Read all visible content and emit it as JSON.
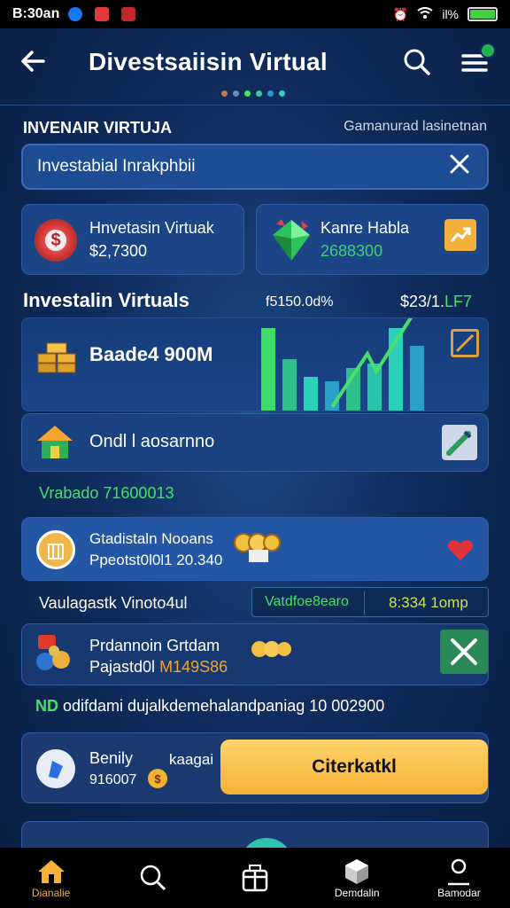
{
  "status_bar": {
    "time": "B:30an",
    "signal_text": "il%"
  },
  "header": {
    "title": "Divestsaiisin Virtual"
  },
  "section": {
    "left_label": "INVENAIR VIRTUJA",
    "right_label": "Gamanurad lasinetnan"
  },
  "search": {
    "value": "Investabial Inrakphbii"
  },
  "cards_row": {
    "left": {
      "title": "Hnvetasin Virtuak",
      "value": "$2,7300"
    },
    "right": {
      "title": "Kanre Habla",
      "value": "2688300"
    }
  },
  "chart_section": {
    "title": "Investalin Virtuals",
    "value_mid": "f5150.0d%",
    "value_right": "$23/1.",
    "value_right_badge": "LF7",
    "box_label": "Baade4 900M"
  },
  "chart_data": {
    "type": "bar",
    "categories": [
      "1",
      "2",
      "3",
      "4",
      "5",
      "6",
      "7",
      "8"
    ],
    "values": [
      95,
      60,
      40,
      35,
      50,
      55,
      95,
      75
    ],
    "ylim": [
      0,
      100
    ]
  },
  "row_oadi": {
    "label": "Ondl l aosarnno"
  },
  "green_label": "Vrabado 71600013",
  "item1": {
    "title": "Gtadistaln Nooans",
    "sub": "Ppeotst0l0l1 20.340"
  },
  "values_row": {
    "left": "Vaulagastk Vinoto4ul",
    "mid": "Vatdfoe8earo",
    "right": "8:334 1omp"
  },
  "item2": {
    "title": "Prdannoin Grtdam",
    "sub": "Pajastd0l",
    "sub_highlight": "M149S86"
  },
  "info_line": {
    "prefix": "ND",
    "text": "odifdami dujalkdemehalandpaniag 10 002900"
  },
  "bottom_card": {
    "title": "Benily",
    "subtitle": "kaagai",
    "value": "916007",
    "cta": "Citerkatkl"
  },
  "nav": [
    {
      "label": "Dianalie",
      "icon": "home-icon",
      "active": true
    },
    {
      "label": "",
      "icon": "search-icon",
      "active": false
    },
    {
      "label": "",
      "icon": "gift-icon",
      "active": false
    },
    {
      "label": "Demdalin",
      "icon": "cube-icon",
      "active": false
    },
    {
      "label": "Bamodar",
      "icon": "user-icon",
      "active": false
    }
  ],
  "colors": {
    "accent_green": "#48e06b",
    "accent_yellow": "#f5b236",
    "background": "#0f2c5c",
    "card": "#1c4587"
  }
}
